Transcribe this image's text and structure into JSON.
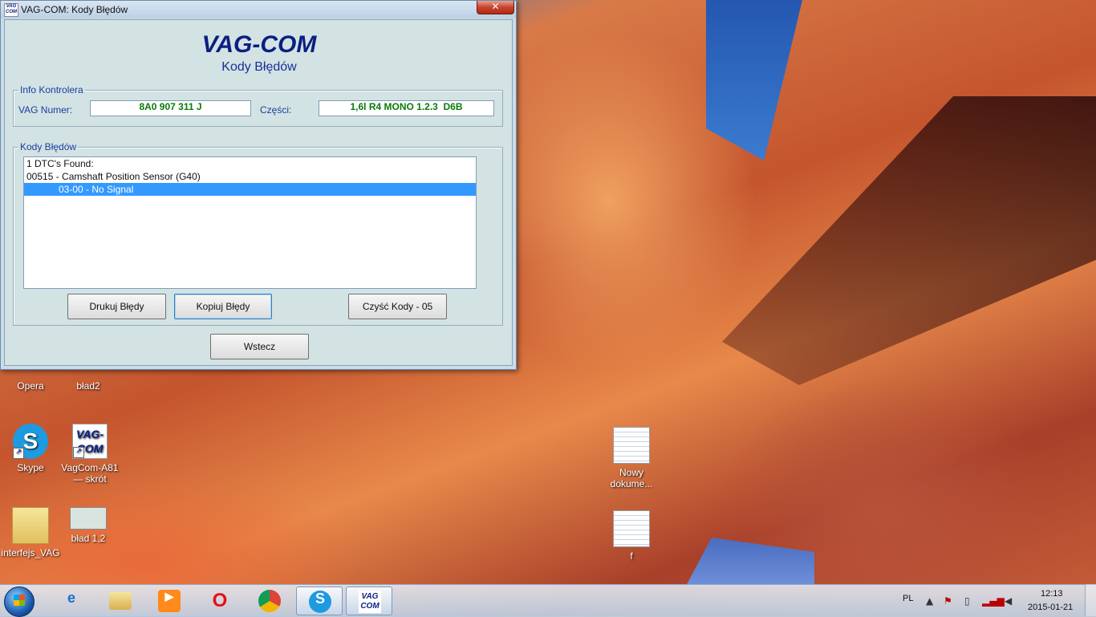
{
  "window": {
    "title": "VAG-COM: Kody Błędów",
    "app_icon_text": "VAG COM",
    "close_glyph": "✕"
  },
  "header": {
    "logo": "VAG-COM",
    "subtitle": "Kody Błędów"
  },
  "controller_info": {
    "legend": "Info Kontrolera",
    "vag_number_label": "VAG Numer:",
    "vag_number_value": "8A0 907 311 J",
    "parts_label": "Części:",
    "parts_value": "1,6l R4 MONO 1.2.3  D6B"
  },
  "fault_codes": {
    "legend": "Kody Błędów",
    "lines": [
      "1 DTC's Found:",
      "00515 - Camshaft Position Sensor (G40)",
      "            03-00 - No Signal"
    ],
    "selected_index": 2
  },
  "buttons": {
    "print": "Drukuj Błędy",
    "copy": "Kopiuj Błędy",
    "clear": "Czyść Kody - 05",
    "back": "Wstecz"
  },
  "desktop_icons": [
    {
      "label": "Opera",
      "icon": "opera-icon"
    },
    {
      "label": "bład2",
      "icon": "image-icon"
    },
    {
      "label": "Skype",
      "icon": "skype-icon"
    },
    {
      "label": "VagCom-A81\n— skrót",
      "icon": "vagcom-icon"
    },
    {
      "label": "interfejs_VAG",
      "icon": "folder-icon"
    },
    {
      "label": "bład 1,2",
      "icon": "image-icon"
    },
    {
      "label": "Nowy\ndokume...",
      "icon": "document-icon"
    },
    {
      "label": "f",
      "icon": "document-icon"
    }
  ],
  "taskbar": {
    "pinned": [
      "ie-icon",
      "explorer-icon",
      "media-player-icon",
      "opera-icon",
      "chrome-icon",
      "skype-icon",
      "vagcom-icon"
    ],
    "vagcom_label": "VAG COM",
    "language": "PL",
    "time": "12:13",
    "date": "2015-01-21"
  },
  "colors": {
    "logo": "#0b1f82",
    "field_value": "#0a7a0a",
    "selection": "#3399ff"
  }
}
